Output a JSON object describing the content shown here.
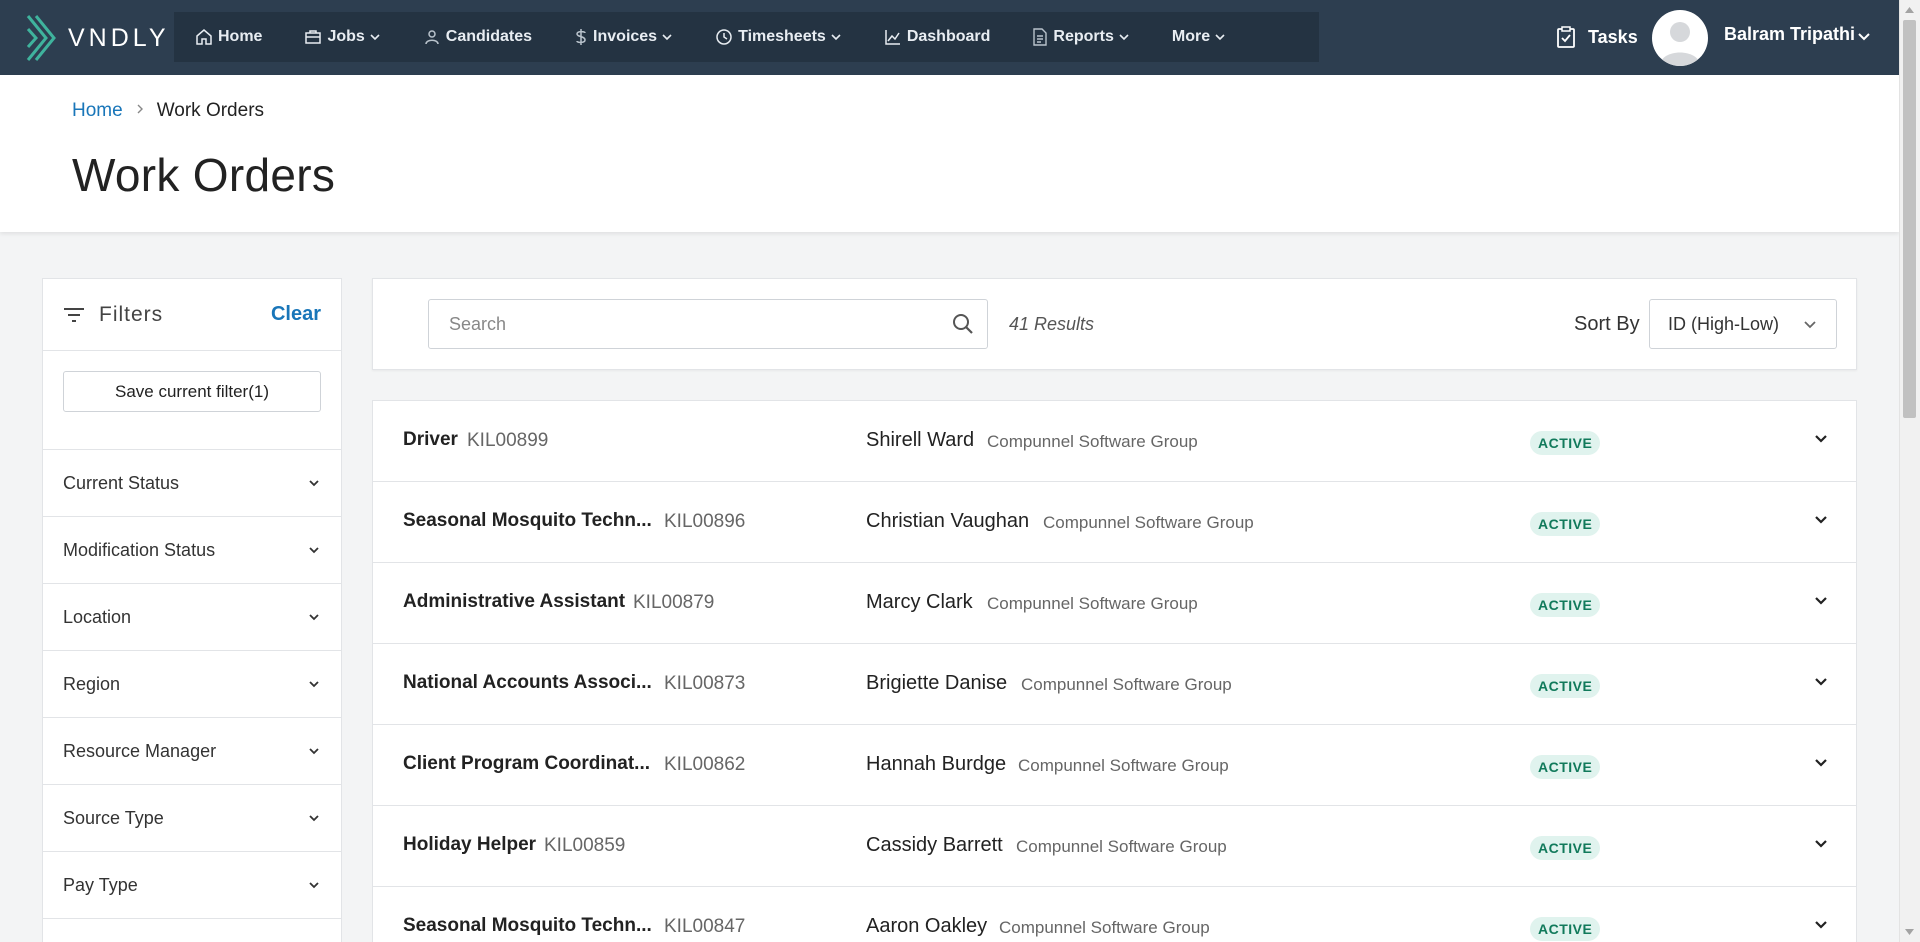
{
  "brand": {
    "name": "VNDLY"
  },
  "nav": {
    "items": [
      {
        "label": "Home",
        "icon": "home-icon",
        "has_menu": false
      },
      {
        "label": "Jobs",
        "icon": "briefcase-icon",
        "has_menu": true
      },
      {
        "label": "Candidates",
        "icon": "person-icon",
        "has_menu": false
      },
      {
        "label": "Invoices",
        "icon": "dollar-icon",
        "has_menu": true
      },
      {
        "label": "Timesheets",
        "icon": "clock-icon",
        "has_menu": true
      },
      {
        "label": "Dashboard",
        "icon": "chart-icon",
        "has_menu": false
      },
      {
        "label": "Reports",
        "icon": "document-icon",
        "has_menu": true
      },
      {
        "label": "More",
        "icon": "",
        "has_menu": true
      }
    ],
    "tasks_label": "Tasks",
    "user_name": "Balram Tripathi"
  },
  "breadcrumb": {
    "home": "Home",
    "current": "Work Orders"
  },
  "page_title": "Work Orders",
  "filters": {
    "title": "Filters",
    "clear_label": "Clear",
    "save_label": "Save current filter(1)",
    "facets": [
      "Current Status",
      "Modification Status",
      "Location",
      "Region",
      "Resource Manager",
      "Source Type",
      "Pay Type"
    ]
  },
  "search": {
    "placeholder": "Search",
    "results_text": "41 Results",
    "sort_label": "Sort By",
    "sort_value": "ID (High-Low)"
  },
  "work_orders": [
    {
      "title": "Driver",
      "id": "KIL00899",
      "candidate": "Shirell Ward",
      "company": "Compunnel Software Group",
      "status": "ACTIVE"
    },
    {
      "title": "Seasonal Mosquito Techn...",
      "id": "KIL00896",
      "candidate": "Christian Vaughan",
      "company": "Compunnel Software Group",
      "status": "ACTIVE"
    },
    {
      "title": "Administrative Assistant",
      "id": "KIL00879",
      "candidate": "Marcy Clark",
      "company": "Compunnel Software Group",
      "status": "ACTIVE"
    },
    {
      "title": "National Accounts Associ...",
      "id": "KIL00873",
      "candidate": "Brigiette Danise",
      "company": "Compunnel Software Group",
      "status": "ACTIVE"
    },
    {
      "title": "Client Program Coordinat...",
      "id": "KIL00862",
      "candidate": "Hannah Burdge",
      "company": "Compunnel Software Group",
      "status": "ACTIVE"
    },
    {
      "title": "Holiday Helper",
      "id": "KIL00859",
      "candidate": "Cassidy Barrett",
      "company": "Compunnel Software Group",
      "status": "ACTIVE"
    },
    {
      "title": "Seasonal Mosquito Techn...",
      "id": "KIL00847",
      "candidate": "Aaron Oakley",
      "company": "Compunnel Software Group",
      "status": "ACTIVE"
    }
  ],
  "colors": {
    "nav_bg": "#2d3e50",
    "nav_group_bg": "#243342",
    "link_blue": "#1976b9",
    "active_badge_bg": "#e0f3ee",
    "active_badge_text": "#117a5b"
  }
}
